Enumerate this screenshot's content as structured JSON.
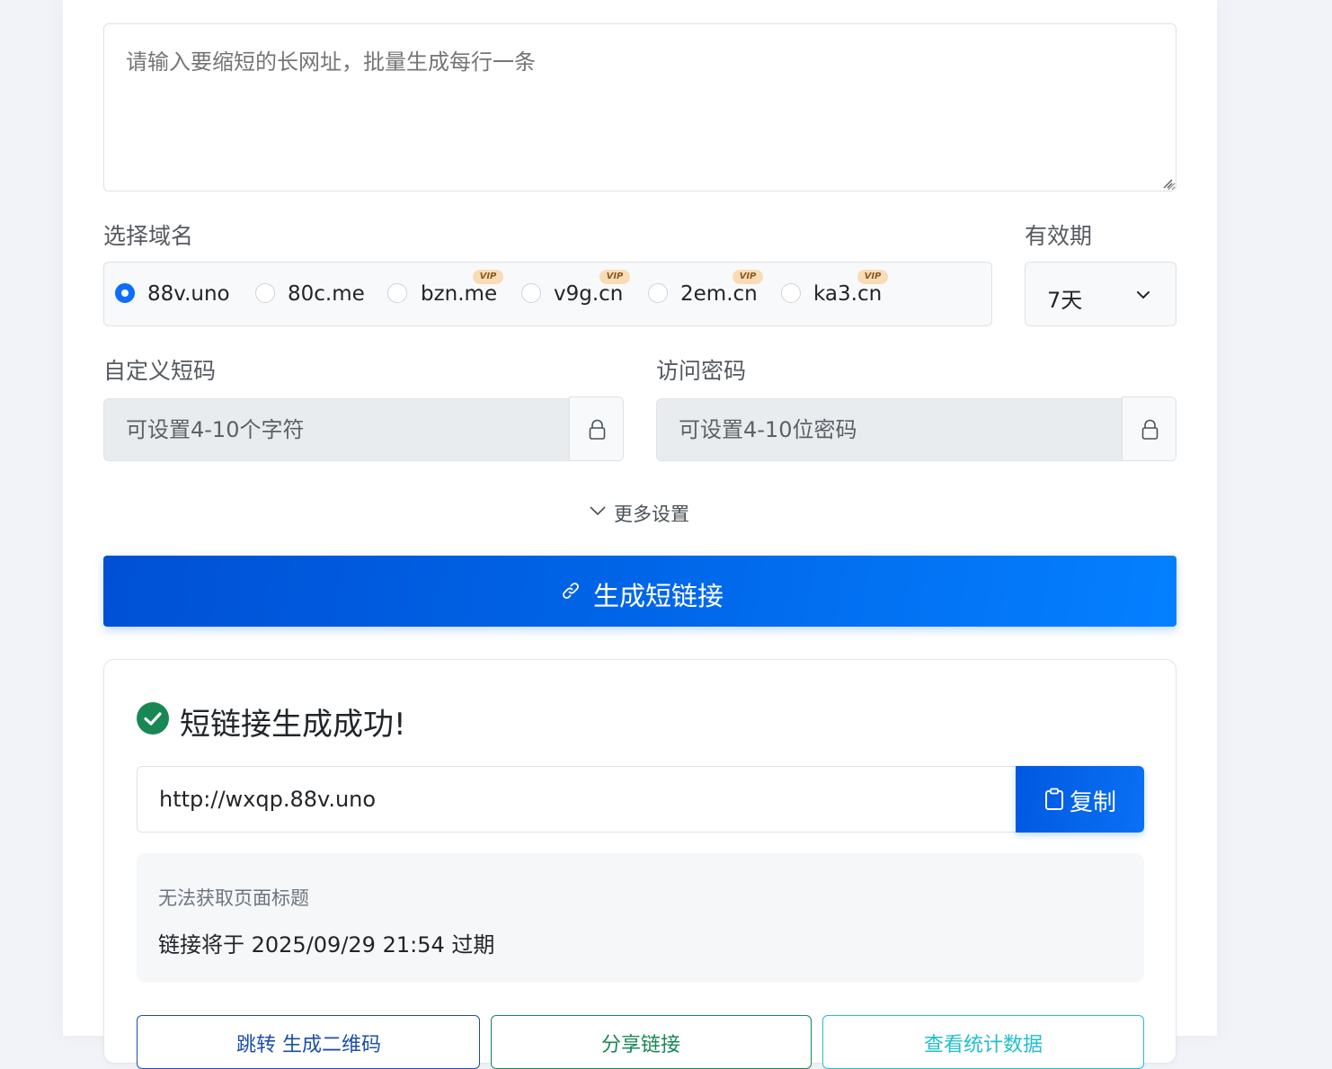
{
  "form": {
    "url_placeholder": "请输入要缩短的长网址，批量生成每行一条",
    "domain_label": "选择域名",
    "expiry_label": "有效期",
    "expiry_value": "7天",
    "domains": [
      {
        "name": "88v.uno",
        "checked": true,
        "vip": false
      },
      {
        "name": "80c.me",
        "checked": false,
        "vip": false
      },
      {
        "name": "bzn.me",
        "checked": false,
        "vip": true
      },
      {
        "name": "v9g.cn",
        "checked": false,
        "vip": true
      },
      {
        "name": "2em.cn",
        "checked": false,
        "vip": true
      },
      {
        "name": "ka3.cn",
        "checked": false,
        "vip": true
      }
    ],
    "vip_badge": "VIP",
    "custom_code_label": "自定义短码",
    "custom_code_placeholder": "可设置4-10个字符",
    "password_label": "访问密码",
    "password_placeholder": "可设置4-10位密码",
    "more_settings": "更多设置",
    "generate_button": "生成短链接"
  },
  "result": {
    "title": "短链接生成成功!",
    "short_url": "http://wxqp.88v.uno",
    "copy_button": "复制",
    "page_title_text": "无法获取页面标题",
    "expire_text": "链接将于 2025/09/29 21:54 过期",
    "actions": [
      "跳转 生成二维码",
      "分享链接",
      "查看统计数据"
    ]
  },
  "colors": {
    "primary": "#0d6efd",
    "success": "#198754",
    "vip_badge": "#f9dcb6",
    "background": "#f1f3f8"
  }
}
